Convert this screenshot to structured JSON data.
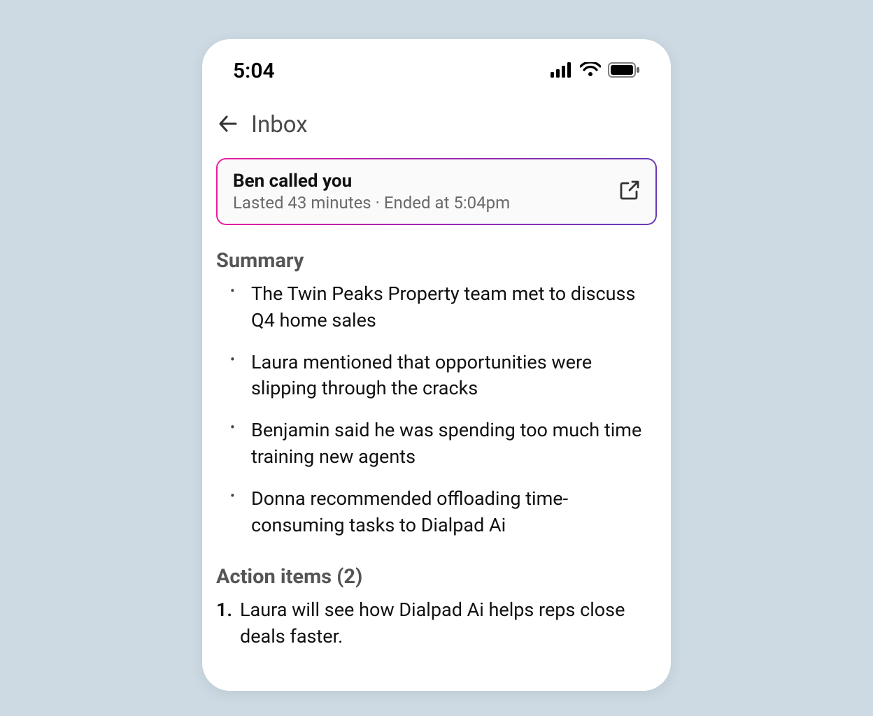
{
  "status_bar": {
    "time": "5:04"
  },
  "nav": {
    "title": "Inbox"
  },
  "call_card": {
    "title": "Ben called you",
    "subtitle": "Lasted 43 minutes · Ended at 5:04pm"
  },
  "summary": {
    "heading": "Summary",
    "items": [
      "The Twin Peaks Property team met to discuss Q4 home sales",
      "Laura mentioned that opportunities were slipping through the cracks",
      "Benjamin said he was spending too much time training new agents",
      "Donna recommended offloading time-consuming tasks to Dialpad Ai"
    ]
  },
  "action_items": {
    "heading": "Action items (2)",
    "items": [
      {
        "number": "1.",
        "text": "Laura will see how Dialpad Ai helps reps close deals faster."
      }
    ]
  }
}
